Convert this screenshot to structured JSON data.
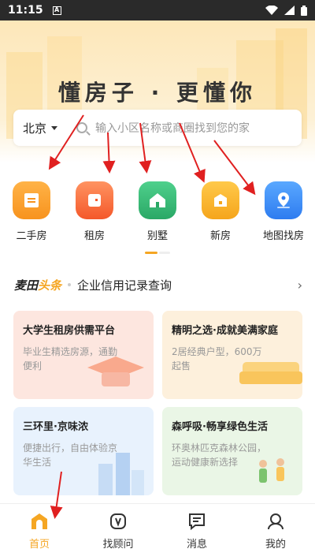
{
  "status": {
    "time": "11:15",
    "notif_icon": "A"
  },
  "hero": {
    "slogan": "懂房子 · 更懂你"
  },
  "search": {
    "city": "北京",
    "placeholder": "输入小区名称或商圈找到您的家"
  },
  "categories": [
    {
      "label": "二手房",
      "icon": "house-doc-icon",
      "color": "#f7931e"
    },
    {
      "label": "租房",
      "icon": "rent-icon",
      "color": "#f4703a"
    },
    {
      "label": "别墅",
      "icon": "villa-icon",
      "color": "#3ec07a"
    },
    {
      "label": "新房",
      "icon": "new-house-icon",
      "color": "#f5b01f"
    },
    {
      "label": "地图找房",
      "icon": "map-pin-icon",
      "color": "#3d8df5"
    }
  ],
  "news": {
    "brand_a": "麦田",
    "brand_b": "头条",
    "text": "企业信用记录查询"
  },
  "cards": [
    {
      "title": "大学生租房供需平台",
      "desc": "毕业生精选房源，通勤便利"
    },
    {
      "title": "精明之选·成就美满家庭",
      "desc": "2居经典户型，600万起售"
    },
    {
      "title": "三环里·京味浓",
      "desc": "便捷出行，自由体验京华生活"
    },
    {
      "title": "森呼吸·畅享绿色生活",
      "desc": "环奥林匹克森林公园，运动健康新选择"
    }
  ],
  "tabs": [
    {
      "label": "首页",
      "icon": "home-icon"
    },
    {
      "label": "找顾问",
      "icon": "advisor-icon"
    },
    {
      "label": "消息",
      "icon": "message-icon"
    },
    {
      "label": "我的",
      "icon": "profile-icon"
    }
  ],
  "colors": {
    "accent": "#f5a623",
    "arrow": "#e02020"
  }
}
